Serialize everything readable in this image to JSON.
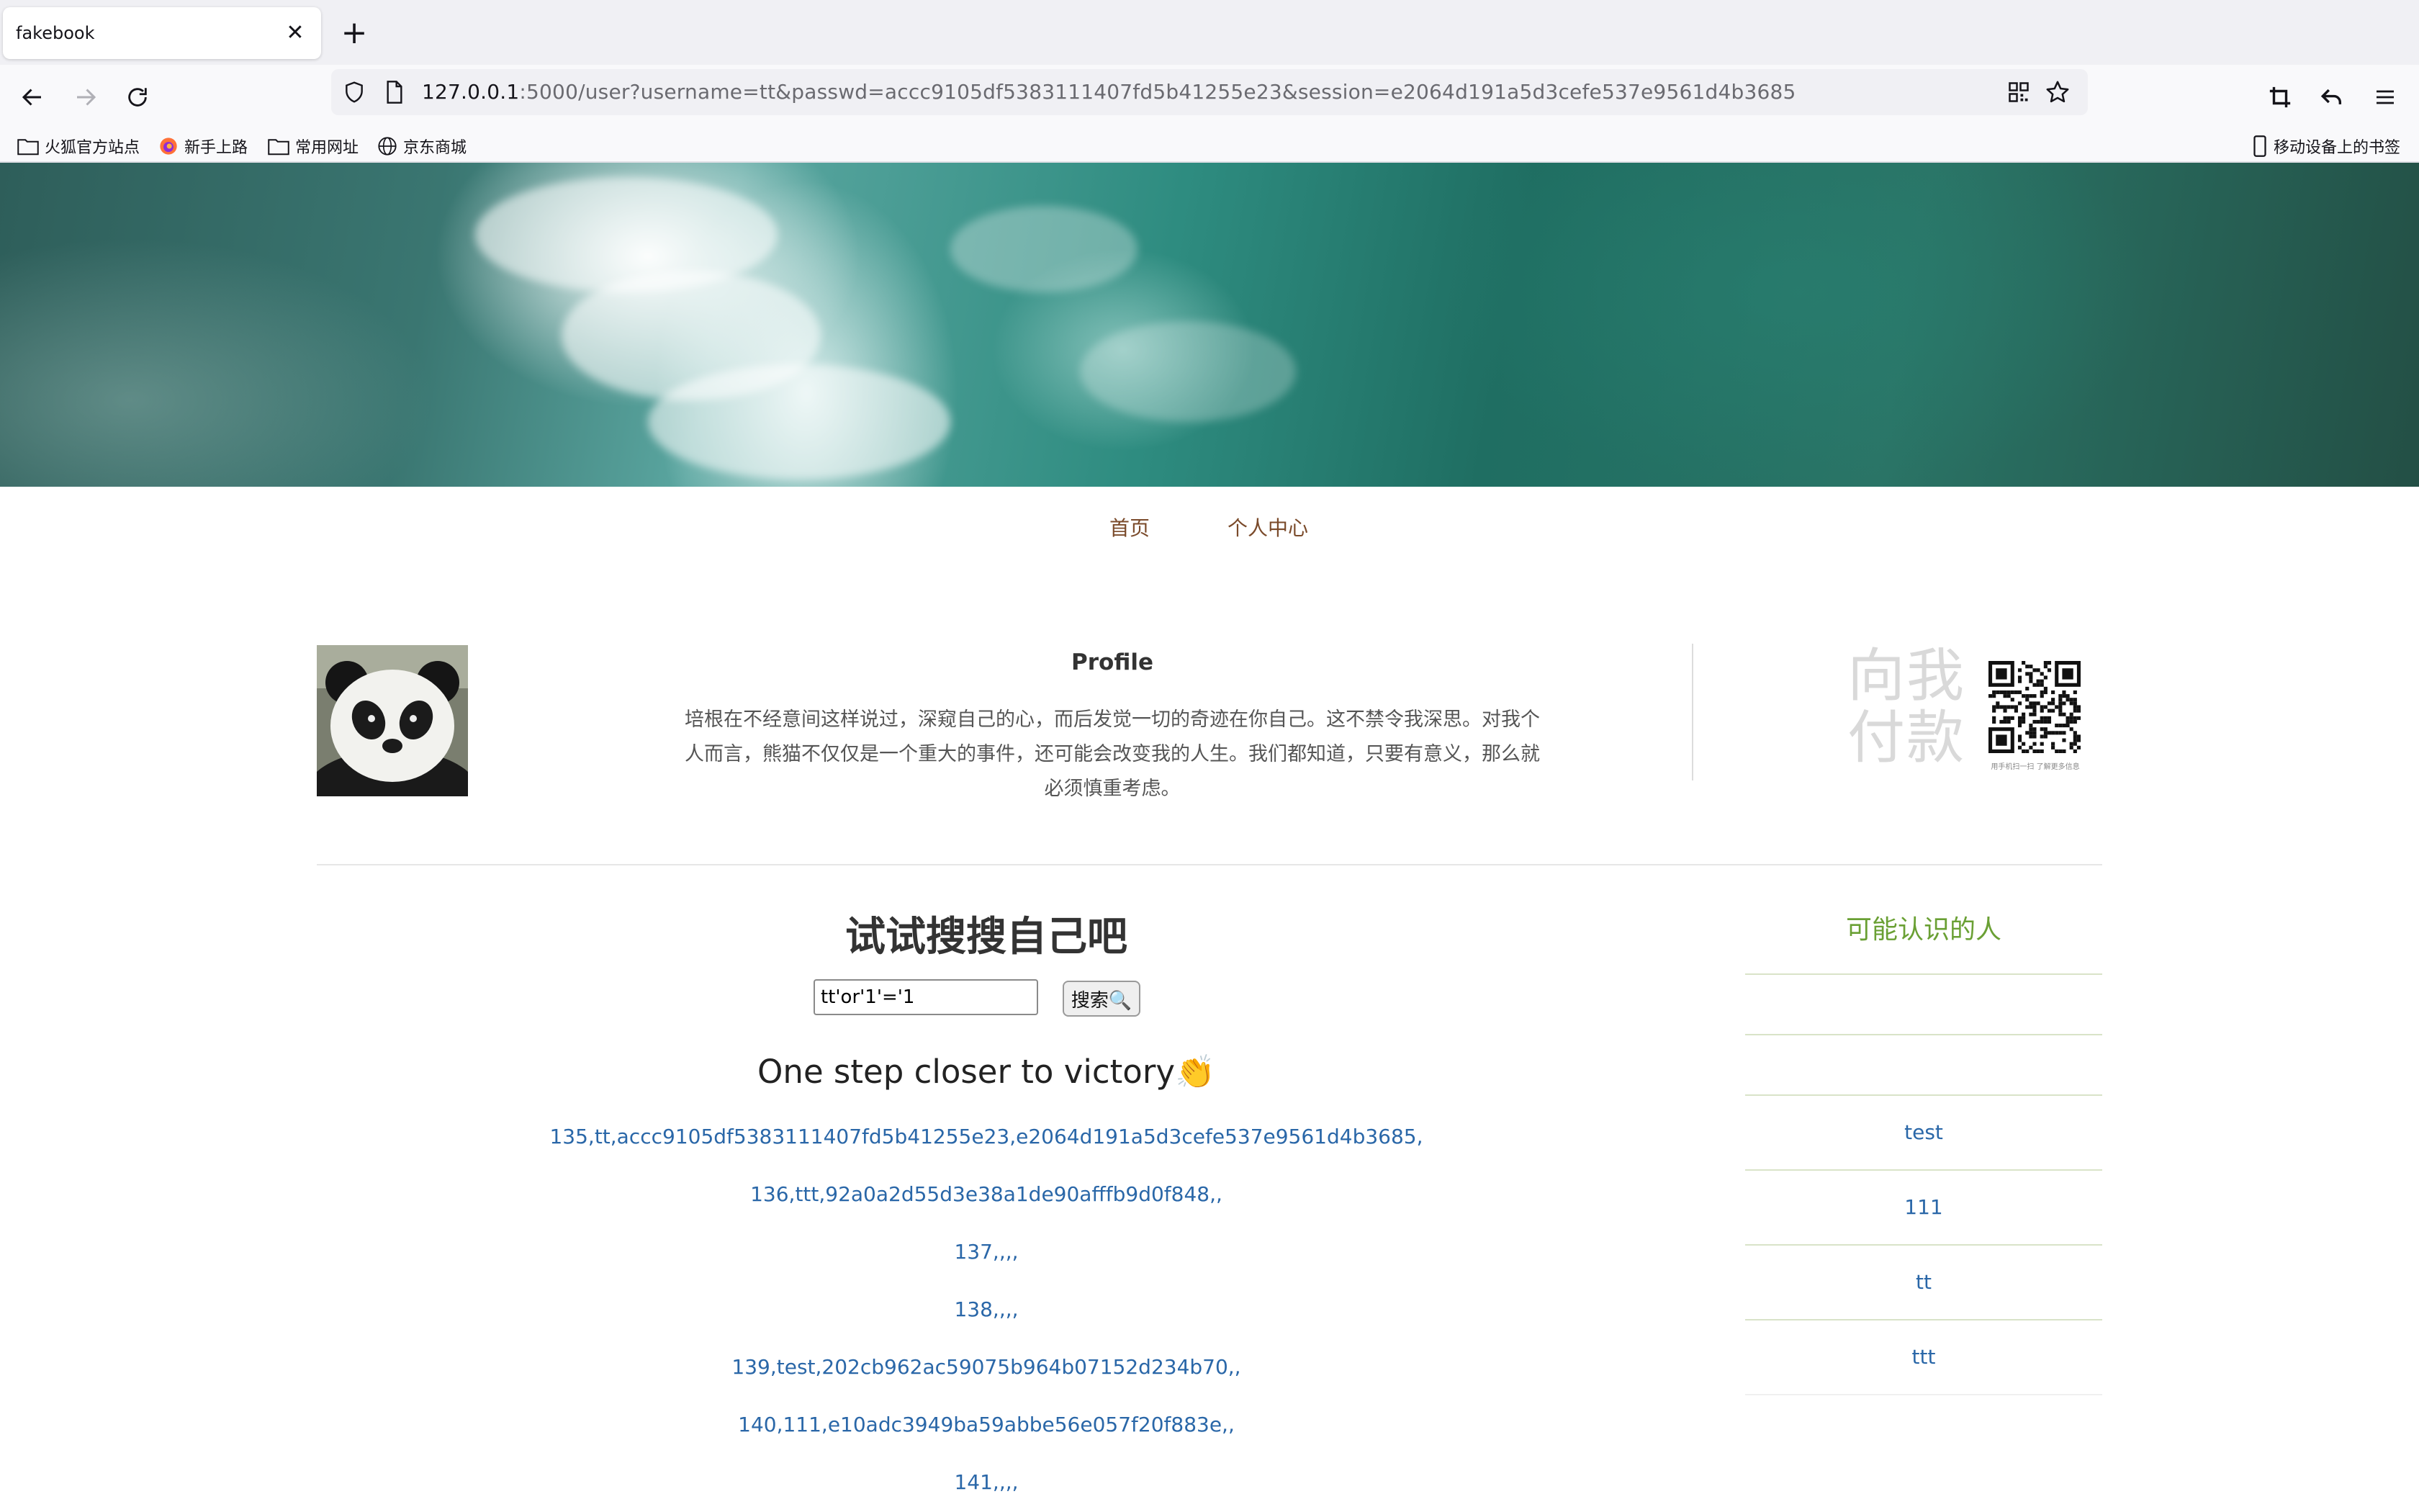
{
  "browser": {
    "tab_title": "fakebook",
    "url_host": "127.0.0.1",
    "url_rest": ":5000/user?username=tt&passwd=accc9105df5383111407fd5b41255e23&session=e2064d191a5d3cefe537e9561d4b3685",
    "bookmarks": [
      "火狐官方站点",
      "新手上路",
      "常用网址",
      "京东商城"
    ],
    "mobile_bookmarks": "移动设备上的书签"
  },
  "nav": {
    "home": "首页",
    "profile": "个人中心"
  },
  "profile": {
    "title": "Profile",
    "text": "培根在不经意间这样说过，深窥自己的心，而后发觉一切的奇迹在你自己。这不禁令我深思。对我个人而言，熊猫不仅仅是一个重大的事件，还可能会改变我的人生。我们都知道，只要有意义，那么就必须慎重考虑。",
    "pay_line1": "向我",
    "pay_line2": "付款",
    "qr_caption": "用手机扫一扫 了解更多信息"
  },
  "search": {
    "title": "试试搜搜自己吧",
    "input_value": "tt'or'1'='1",
    "button_label": "搜索🔍",
    "victory": "One step closer to victory👏",
    "results": [
      "135,tt,accc9105df5383111407fd5b41255e23,e2064d191a5d3cefe537e9561d4b3685,",
      "136,ttt,92a0a2d55d3e38a1de90afffb9d0f848,,",
      "137,,,,",
      "138,,,,",
      "139,test,202cb962ac59075b964b07152d234b70,,",
      "140,111,e10adc3949ba59abbe56e057f20f883e,,",
      "141,,,,"
    ]
  },
  "sidebar": {
    "title": "可能认识的人",
    "people": [
      "",
      "",
      "test",
      "111",
      "tt",
      "ttt"
    ]
  },
  "colors": {
    "link": "#2a67a8",
    "sidebar_title": "#6aa034",
    "nav_link": "#7a4a2a"
  }
}
